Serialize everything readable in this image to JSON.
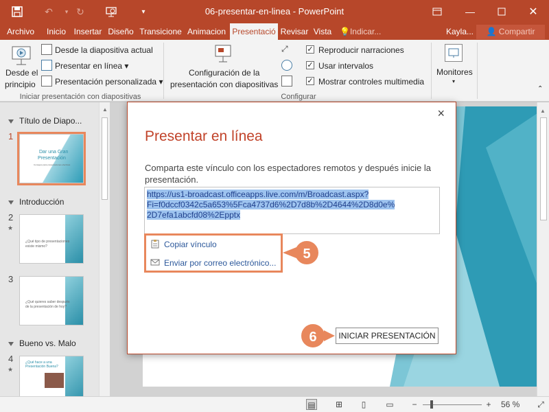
{
  "window": {
    "title": "06-presentar-en-linea  -  PowerPoint",
    "user": "Kayla...",
    "share_label": "Compartir"
  },
  "tabs": [
    {
      "label": "Archivo",
      "active": false
    },
    {
      "label": "Inicio",
      "active": false
    },
    {
      "label": "Insertar",
      "active": false
    },
    {
      "label": "Diseño",
      "active": false
    },
    {
      "label": "Transicione",
      "active": false
    },
    {
      "label": "Animacion",
      "active": false
    },
    {
      "label": "Presentació",
      "active": true
    },
    {
      "label": "Revisar",
      "active": false
    },
    {
      "label": "Vista",
      "active": false
    },
    {
      "label": "Indicar...",
      "active": false
    }
  ],
  "ribbon": {
    "from_start_label_1": "Desde el",
    "from_start_label_2": "principio",
    "from_current": "Desde la diapositiva actual",
    "present_online": "Presentar en línea",
    "custom_show": "Presentación personalizada",
    "group_start": "Iniciar presentación con diapositivas",
    "setup_label_1": "Configuración de la",
    "setup_label_2": "presentación con diapositivas",
    "play_narrations": "Reproducir narraciones",
    "use_timings": "Usar intervalos",
    "show_media_controls": "Mostrar controles multimedia",
    "group_setup": "Configurar",
    "monitors": "Monitores"
  },
  "slides_panel": {
    "sections": [
      {
        "title": "Título de Diapo..."
      },
      {
        "title": "Introducción"
      },
      {
        "title": "Bueno vs. Malo"
      }
    ],
    "slides": [
      {
        "number": "1",
        "title_1": "Dar una Gran",
        "title_2": "Presentación",
        "subtitle": "Consejos para presentaciones efectivas"
      },
      {
        "number": "2",
        "star": "★",
        "text_1": "¿Qué tipo de presentaciones",
        "text_2": "existe mismo?"
      },
      {
        "number": "3",
        "text_1": "¿Qué quieres saber después",
        "text_2": "de la presentación de hoy?"
      },
      {
        "number": "4",
        "star": "★",
        "text_1": "¿Qué hace a una",
        "text_2": "Presentación Buena?"
      }
    ]
  },
  "dialog": {
    "title": "Presentar en línea",
    "description": "Comparta este vínculo con los espectadores remotos y después inicie la presentación.",
    "link_line_1": "https://us1-broadcast.officeapps.live.com/m/Broadcast.aspx?",
    "link_line_2": "Fi=f0dccf0342c5a653%5Fca4737d6%2D7d8b%2D4644%2D8d0e%",
    "link_line_3": "2D7efa1abcfd08%2Epptx",
    "copy_link": "Copiar vínculo",
    "email": "Enviar por correo electrónico...",
    "start_button": "INICIAR PRESENTACIÓN",
    "close": "×"
  },
  "callouts": {
    "step_5": "5",
    "step_6": "6",
    "color": "#e8875c"
  },
  "statusbar": {
    "zoom": "56 %",
    "minus": "−",
    "plus": "+"
  },
  "colors": {
    "accent": "#b7472a",
    "dialog_title": "#c1432a",
    "link_highlight": "#9dc3ef"
  }
}
